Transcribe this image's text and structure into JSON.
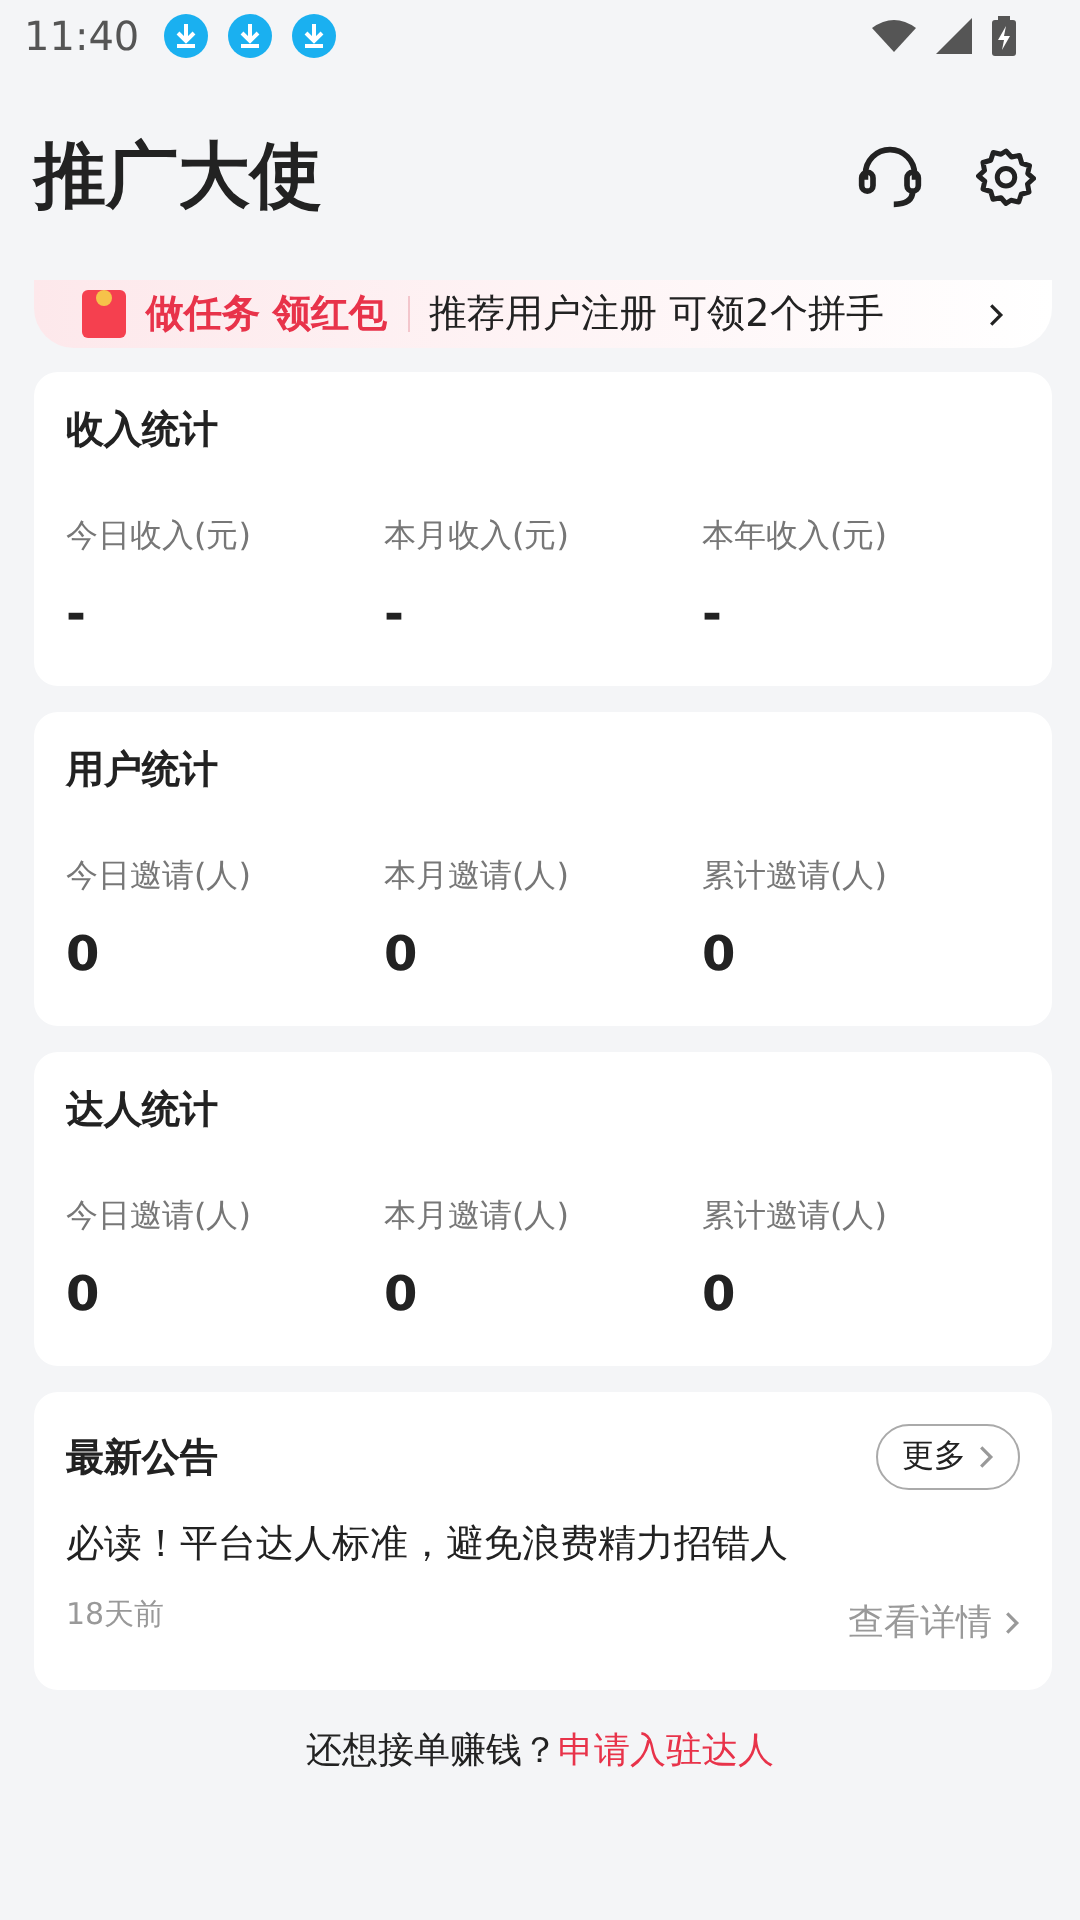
{
  "status_bar": {
    "time": "11:40",
    "notifications": [
      {
        "kind": "download"
      },
      {
        "kind": "download"
      },
      {
        "kind": "download"
      }
    ]
  },
  "header": {
    "title": "推广大使"
  },
  "banner": {
    "tag": "做任务 领红包",
    "text": "推荐用户注册 可领2个拼手"
  },
  "stat_cards": [
    {
      "title": "收入统计",
      "stats": [
        {
          "label": "今日收入(元)",
          "value": "-"
        },
        {
          "label": "本月收入(元)",
          "value": "-"
        },
        {
          "label": "本年收入(元)",
          "value": "-"
        }
      ]
    },
    {
      "title": "用户统计",
      "stats": [
        {
          "label": "今日邀请(人)",
          "value": "0"
        },
        {
          "label": "本月邀请(人)",
          "value": "0"
        },
        {
          "label": "累计邀请(人)",
          "value": "0"
        }
      ]
    },
    {
      "title": "达人统计",
      "stats": [
        {
          "label": "今日邀请(人)",
          "value": "0"
        },
        {
          "label": "本月邀请(人)",
          "value": "0"
        },
        {
          "label": "累计邀请(人)",
          "value": "0"
        }
      ]
    }
  ],
  "announcements": {
    "title": "最新公告",
    "more": "更多",
    "headline": "必读！平台达人标准，避免浪费精力招错人",
    "time": "18天前",
    "details": "查看详情"
  },
  "footer": {
    "question": "还想接单赚钱？",
    "link": "申请入驻达人"
  }
}
